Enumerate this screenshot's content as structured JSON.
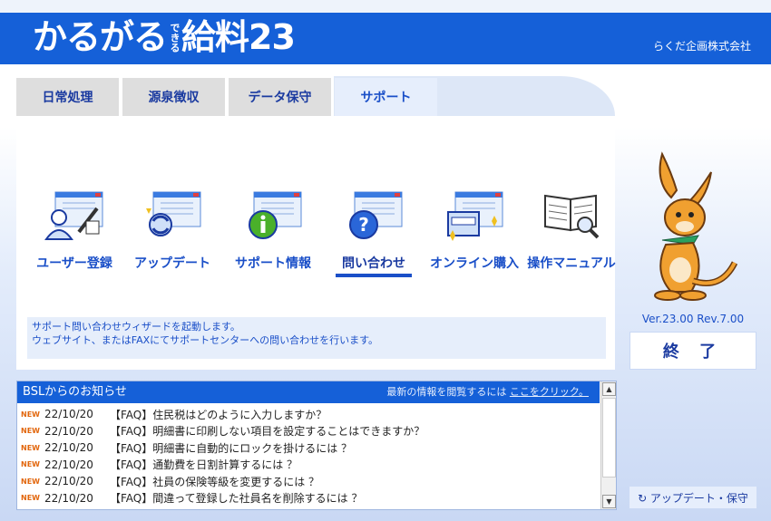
{
  "header": {
    "logo_main": "かるがる",
    "logo_small": "できる",
    "logo_tail": "給料23",
    "company": "らくだ企画株式会社"
  },
  "tabs": [
    {
      "label": "日常処理"
    },
    {
      "label": "源泉徴収"
    },
    {
      "label": "データ保守"
    },
    {
      "label": "サポート"
    }
  ],
  "icons": [
    {
      "label": "ユーザー登録",
      "icon": "user-registration-icon"
    },
    {
      "label": "アップデート",
      "icon": "update-icon"
    },
    {
      "label": "サポート情報",
      "icon": "info-icon"
    },
    {
      "label": "問い合わせ",
      "icon": "question-icon"
    },
    {
      "label": "オンライン購入",
      "icon": "online-purchase-icon"
    },
    {
      "label": "操作マニュアル",
      "icon": "manual-icon"
    }
  ],
  "description": {
    "line1": "サポート問い合わせウィザードを起動します。",
    "line2": "ウェブサイト、またはFAXにてサポートセンターへの問い合わせを行います。"
  },
  "side": {
    "version": "Ver.23.00 Rev.7.00",
    "exit_label": "終 了",
    "update_label": "↻ アップデート・保守"
  },
  "news": {
    "title": "BSLからのお知らせ",
    "link_prefix": "最新の情報を閲覧するには ",
    "link_text": "ここをクリック。",
    "new_badge": "NEW",
    "items": [
      {
        "date": "22/10/20",
        "title": "【FAQ】住民税はどのように入力しますか？"
      },
      {
        "date": "22/10/20",
        "title": "【FAQ】明細書に印刷しない項目を設定することはできますか？"
      },
      {
        "date": "22/10/20",
        "title": "【FAQ】明細書に自動的にロックを掛けるには ？"
      },
      {
        "date": "22/10/20",
        "title": "【FAQ】通勤費を日割計算するには ？"
      },
      {
        "date": "22/10/20",
        "title": "【FAQ】社員の保険等級を変更するには ？"
      },
      {
        "date": "22/10/20",
        "title": "【FAQ】間違って登録した社員名を削除するには ？"
      }
    ]
  },
  "colors": {
    "brand": "#1560d8",
    "accent": "#1a4fc8",
    "new_badge": "#e2660c"
  }
}
